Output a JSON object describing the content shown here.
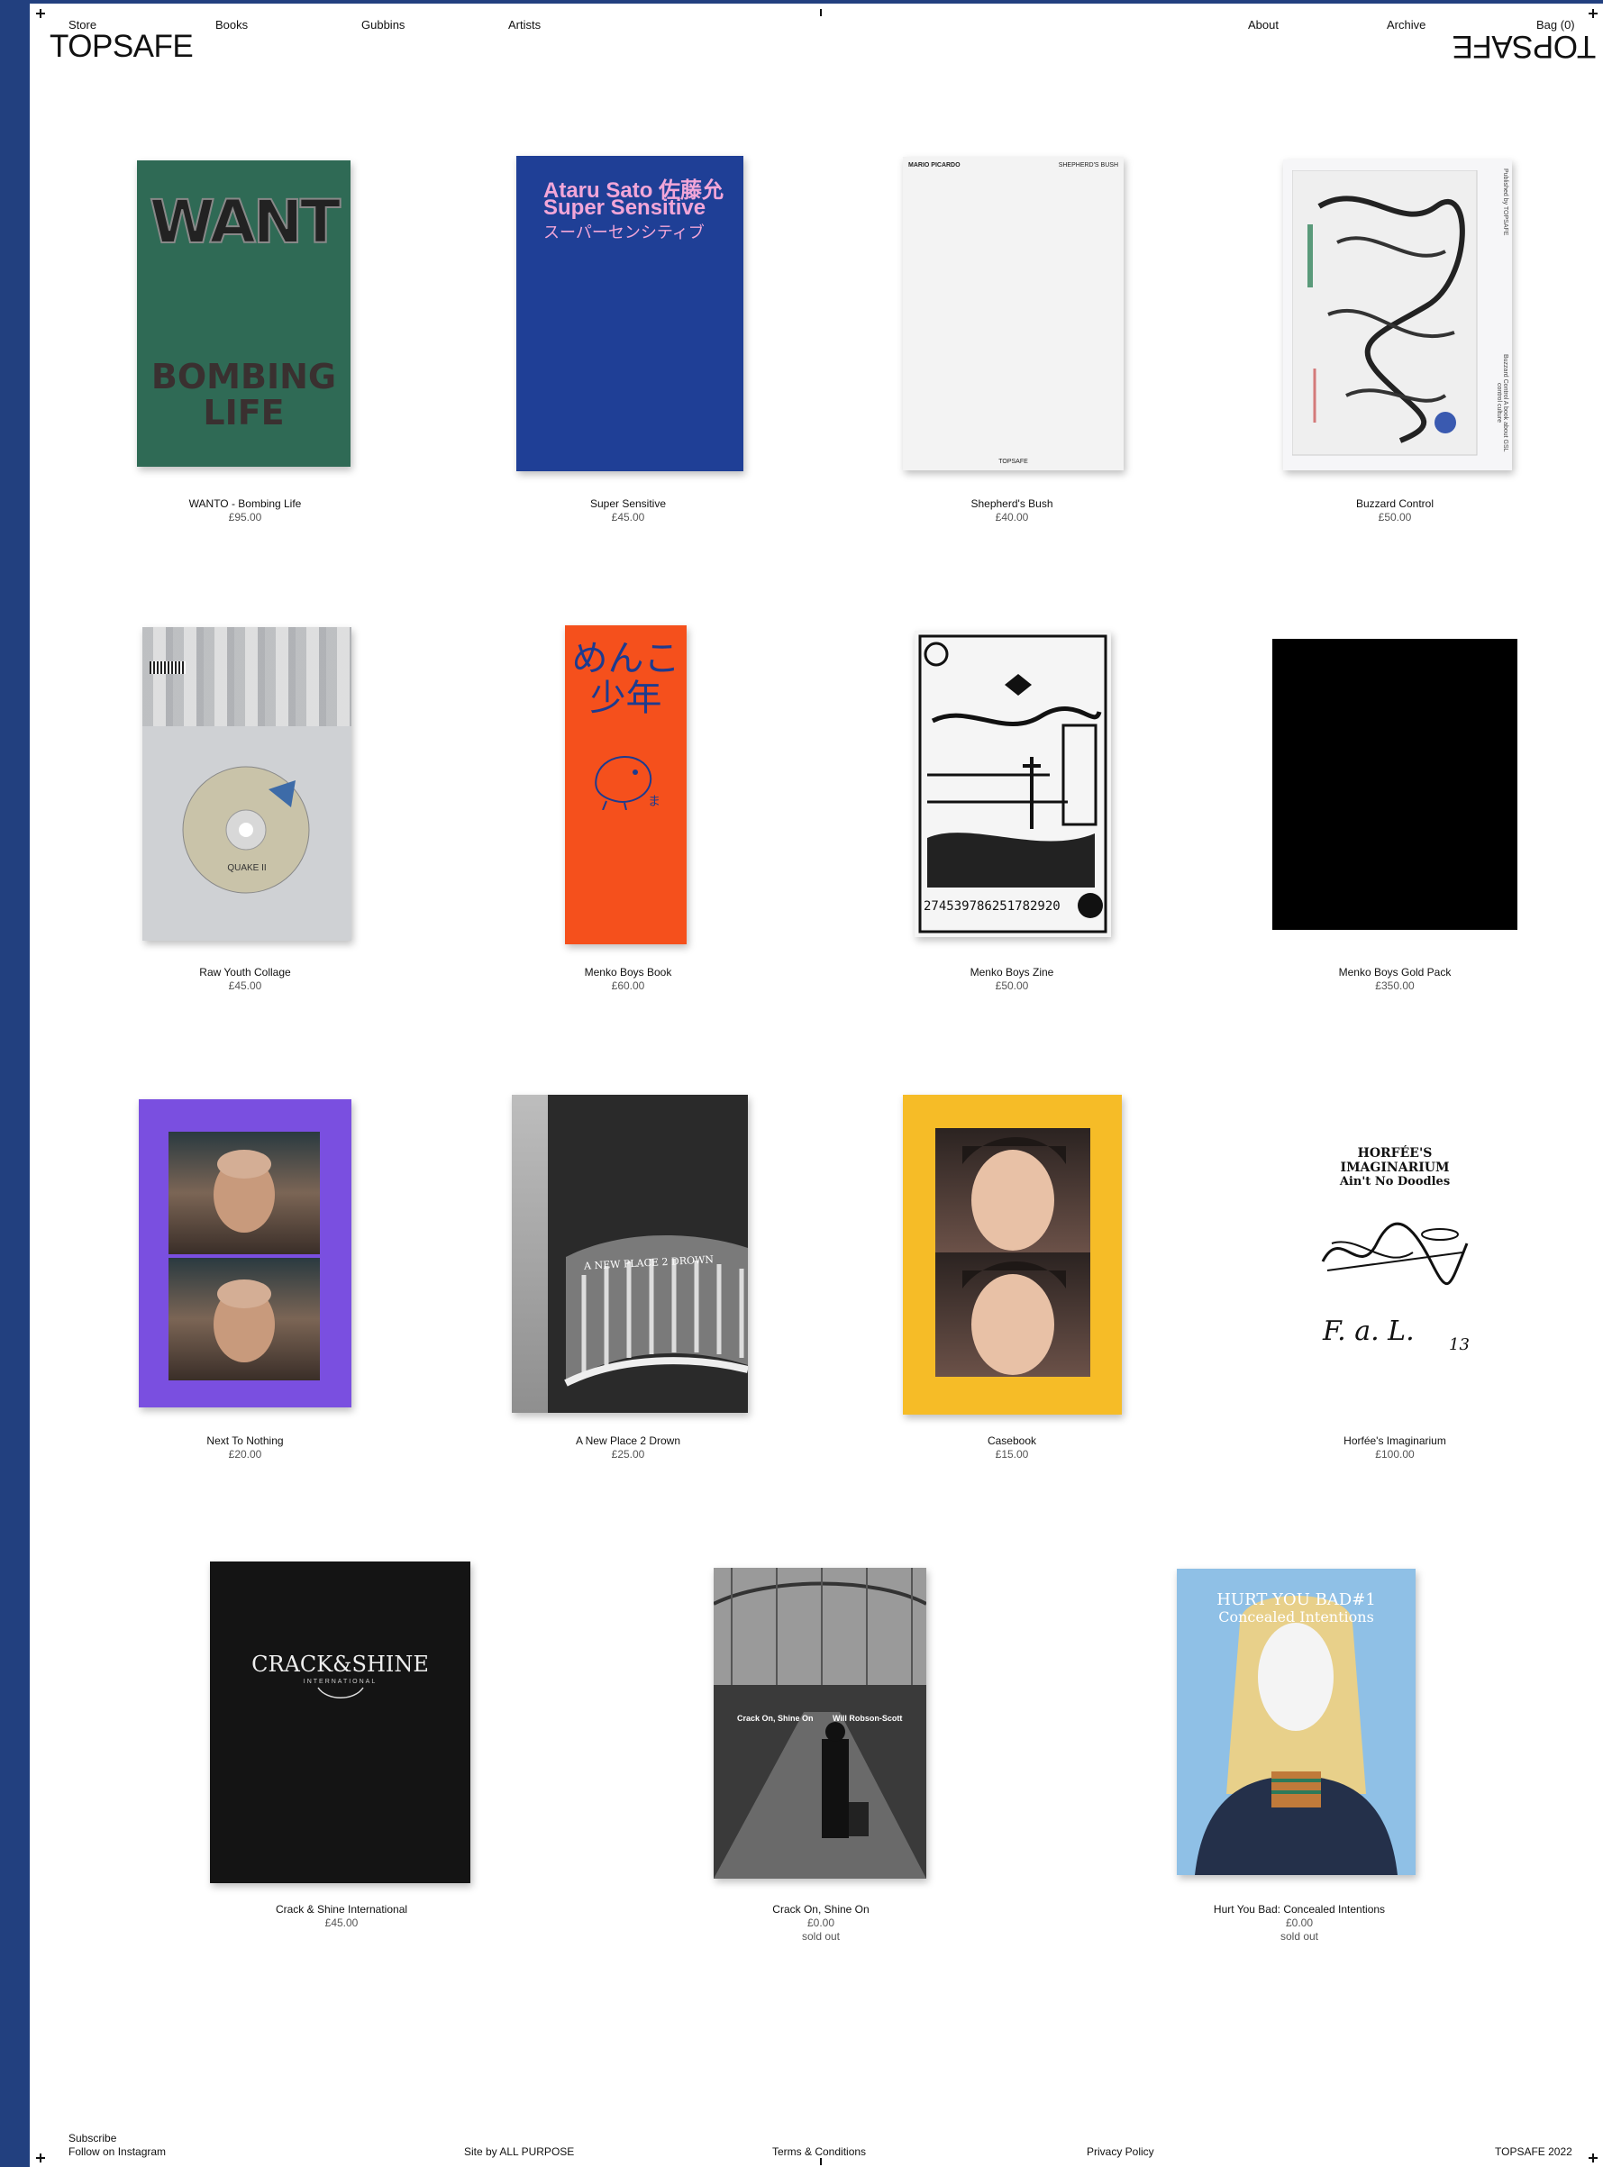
{
  "nav": {
    "left": [
      "Store",
      "Books",
      "Gubbins",
      "Artists"
    ],
    "right": [
      "About",
      "Archive",
      "Bag (0)"
    ]
  },
  "brand": {
    "logo": "TOPSAFE"
  },
  "products": [
    {
      "name": "WANTO - Bombing Life",
      "price": "£95.00",
      "cover_text": [
        "WANT",
        "BOMBING",
        "LIFE"
      ]
    },
    {
      "name": "Super Sensitive",
      "price": "£45.00",
      "cover_text": [
        "Ataru Sato 佐藤允",
        "Super Sensitive",
        "スーパーセンシティブ"
      ]
    },
    {
      "name": "Shepherd's Bush",
      "price": "£40.00",
      "cover_text": [
        "MARIO PICARDO",
        "SHEPHERD'S BUSH",
        "TOPSAFE"
      ]
    },
    {
      "name": "Buzzard Control",
      "price": "£50.00",
      "cover_text": [
        "Published by TOPSAFE",
        "Buzzard Control A book about GSL control culture"
      ]
    },
    {
      "name": "Raw Youth Collage",
      "price": "£45.00",
      "cover_text": [
        "QUAKE II"
      ]
    },
    {
      "name": "Menko Boys Book",
      "price": "£60.00",
      "cover_text": [
        "めんこ",
        "少年",
        "ま"
      ]
    },
    {
      "name": "Menko Boys Zine",
      "price": "£50.00",
      "cover_text": [
        "274539786251782920"
      ]
    },
    {
      "name": "Menko Boys Gold Pack",
      "price": "£350.00"
    },
    {
      "name": "Next To Nothing",
      "price": "£20.00"
    },
    {
      "name": "A New Place 2 Drown",
      "price": "£25.00",
      "cover_text": [
        "A NEW PLACE 2 DROWN"
      ]
    },
    {
      "name": "Casebook",
      "price": "£15.00"
    },
    {
      "name": "Horfée's Imaginarium",
      "price": "£100.00",
      "cover_text": [
        "HORFÉE'S",
        "IMAGINARIUM",
        "Ain't No Doodles",
        "F. a. L.",
        "13"
      ]
    },
    {
      "name": "Crack & Shine International",
      "price": "£45.00",
      "cover_text": [
        "CRACK&SHINE",
        "INTERNATIONAL"
      ]
    },
    {
      "name": "Crack On, Shine On",
      "price": "£0.00",
      "status": "sold out",
      "cover_text": [
        "Crack On, Shine On",
        "Will Robson-Scott"
      ]
    },
    {
      "name": "Hurt You Bad: Concealed Intentions",
      "price": "£0.00",
      "status": "sold out",
      "cover_text": [
        "HURT YOU BAD#1",
        "Concealed Intentions"
      ]
    }
  ],
  "footer": {
    "subscribe": "Subscribe",
    "instagram": "Follow on Instagram",
    "credit": "Site by ALL PURPOSE",
    "terms": "Terms & Conditions",
    "privacy": "Privacy Policy",
    "copyright": "TOPSAFE 2022"
  },
  "colors": {
    "accent": "#22407f",
    "wanto_cover": "#2f6a55",
    "super_sensitive_cover": "#1f3f96",
    "menko_book_cover": "#f5501c",
    "next_to_nothing_cover": "#7a4fe0",
    "casebook_cover": "#f6bc27"
  }
}
